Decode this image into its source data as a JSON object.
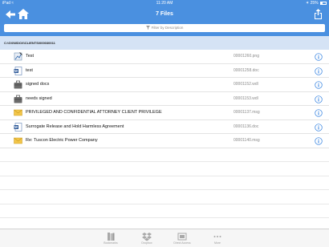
{
  "status_bar": {
    "device": "iPad",
    "wifi": "wifi-icon",
    "time": "11:20 AM",
    "bluetooth": "bluetooth-icon",
    "battery": "25%"
  },
  "nav": {
    "title": "7 Files",
    "back": "back-arrow-icon",
    "home": "home-icon",
    "share": "share-icon"
  },
  "filter": {
    "placeholder": "Filter by Description",
    "icon": "funnel-icon"
  },
  "path": "C:\\GX\\WDOX\\CLIENTS\\000030011",
  "files": [
    {
      "name": "Test",
      "number": "00001260.png",
      "icon": "image-file-icon"
    },
    {
      "name": "test",
      "number": "00001258.doc",
      "icon": "word-doc-icon"
    },
    {
      "name": "signed docs",
      "number": "00001152.wdl",
      "icon": "briefcase-icon"
    },
    {
      "name": "needs signed",
      "number": "00001153.wdl",
      "icon": "briefcase-icon"
    },
    {
      "name": "PRIVILEGED AND CONFIDENTIAL ATTORNEY CLIENT PRIVILEGE",
      "number": "00001137.msg",
      "icon": "envelope-icon"
    },
    {
      "name": "Surrogate Release and Hold Harmless Agreement",
      "number": "00001136.doc",
      "icon": "word-doc-icon"
    },
    {
      "name": "Re: Tuscon Electric Power Company",
      "number": "00001140.msg",
      "icon": "envelope-icon"
    }
  ],
  "tabs": [
    {
      "label": "Bookmarks",
      "icon": "bookmarks-icon"
    },
    {
      "label": "Dropbox",
      "icon": "dropbox-icon"
    },
    {
      "label": "Direct Access",
      "icon": "direct-access-icon"
    },
    {
      "label": "More",
      "icon": "more-icon"
    }
  ],
  "colors": {
    "accent": "#4a90e0",
    "path_bg": "#d5e3f5",
    "info": "#2f7fe0"
  }
}
